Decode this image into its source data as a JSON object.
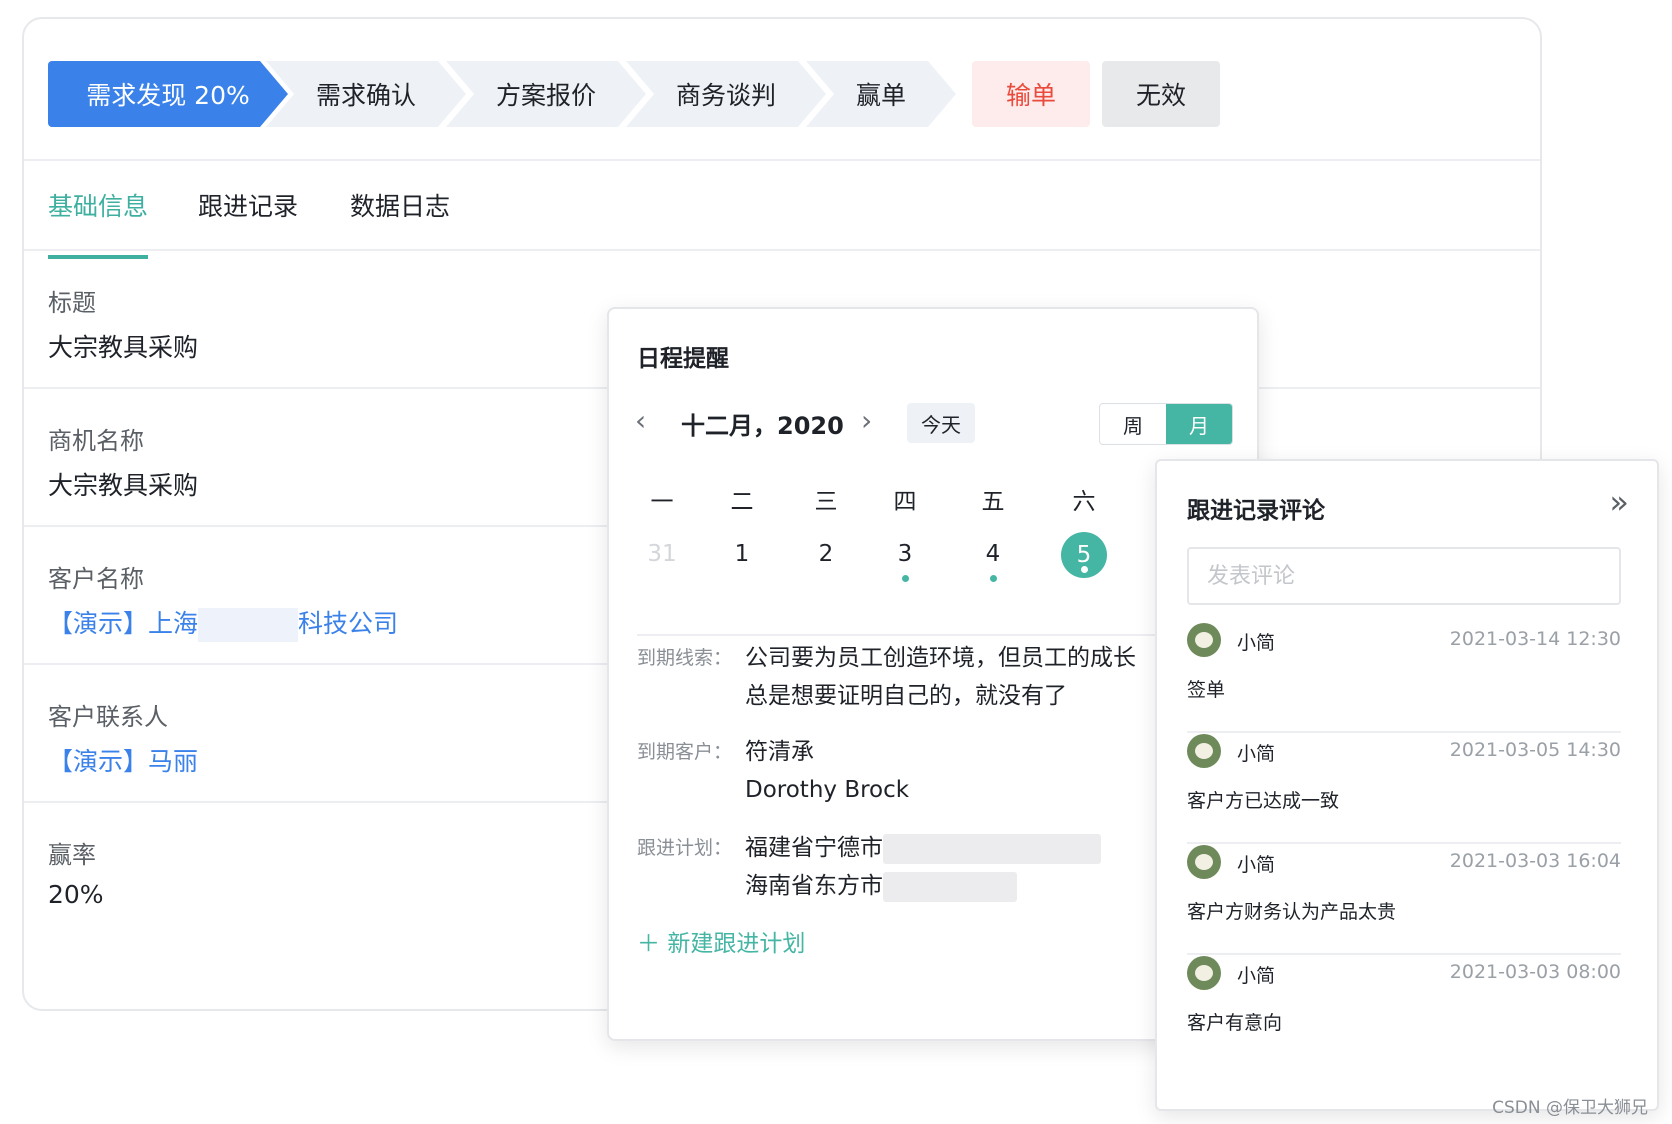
{
  "stages": [
    {
      "label": "需求发现 20%",
      "state": "active"
    },
    {
      "label": "需求确认",
      "state": "pending"
    },
    {
      "label": "方案报价",
      "state": "pending"
    },
    {
      "label": "商务谈判",
      "state": "pending"
    },
    {
      "label": "赢单",
      "state": "pending"
    },
    {
      "label": "输单",
      "state": "lose"
    },
    {
      "label": "无效",
      "state": "invalid"
    }
  ],
  "tabs": [
    "基础信息",
    "跟进记录",
    "数据日志"
  ],
  "fields": {
    "title": {
      "label": "标题",
      "value": "大宗教具采购"
    },
    "opportunity": {
      "label": "商机名称",
      "value": "大宗教具采购"
    },
    "customer": {
      "label": "客户名称",
      "value_prefix": "【演示】上海",
      "value_suffix": "科技公司"
    },
    "contact": {
      "label": "客户联系人",
      "value": "【演示】马丽"
    },
    "win_rate": {
      "label": "赢率",
      "value": "20%"
    }
  },
  "schedule": {
    "title": "日程提醒",
    "month_label": "十二月，2020",
    "today_label": "今天",
    "view_week": "周",
    "view_month": "月",
    "weekdays": [
      "一",
      "二",
      "三",
      "四",
      "五",
      "六"
    ],
    "days": [
      "31",
      "1",
      "2",
      "3",
      "4",
      "5"
    ],
    "due_clue_label": "到期线索：",
    "due_clue_line1": "公司要为员工创造环境，但员工的成长",
    "due_clue_line2": "总是想要证明自己的，就没有了",
    "due_customer_label": "到期客户：",
    "due_customer_1": "符清承",
    "due_customer_2": "Dorothy Brock",
    "plan_label": "跟进计划：",
    "plan_1": "福建省宁德市",
    "plan_2": "海南省东方市",
    "new_plan": "新建跟进计划"
  },
  "comments": {
    "title": "跟进记录评论",
    "placeholder": "发表评论",
    "items": [
      {
        "name": "小简",
        "time": "2021-03-14 12:30",
        "text": "签单"
      },
      {
        "name": "小简",
        "time": "2021-03-05 14:30",
        "text": "客户方已达成一致"
      },
      {
        "name": "小简",
        "time": "2021-03-03 16:04",
        "text": "客户方财务认为产品太贵"
      },
      {
        "name": "小简",
        "time": "2021-03-03 08:00",
        "text": "客户有意向"
      }
    ]
  },
  "watermark": "CSDN @保卫大狮兄",
  "colors": {
    "primary": "#3a82ea",
    "accent": "#45b5a4",
    "danger": "#ea4a3c"
  }
}
